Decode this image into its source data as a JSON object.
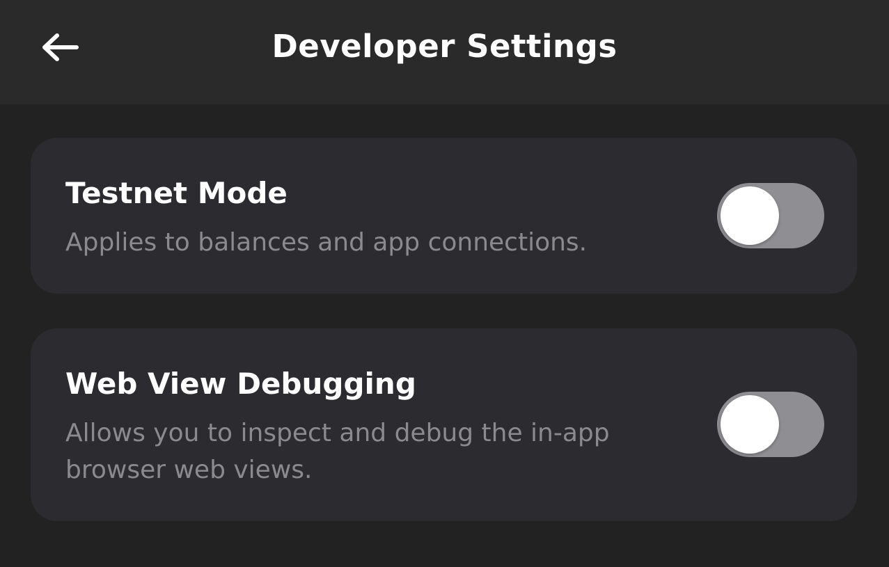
{
  "header": {
    "title": "Developer Settings",
    "back_icon": "arrow-left-icon"
  },
  "settings": [
    {
      "title": "Testnet Mode",
      "description": "Applies to balances and app connections.",
      "enabled": false
    },
    {
      "title": "Web View Debugging",
      "description": "Allows you to inspect and debug the in-app browser web views.",
      "enabled": false
    }
  ],
  "colors": {
    "background": "#222222",
    "header_background": "#2a2a2a",
    "card_background": "#2c2c30",
    "toggle_off_track": "#8e8e93",
    "toggle_knob": "#ffffff",
    "title_text": "#ffffff",
    "description_text": "#8b8b8f"
  }
}
